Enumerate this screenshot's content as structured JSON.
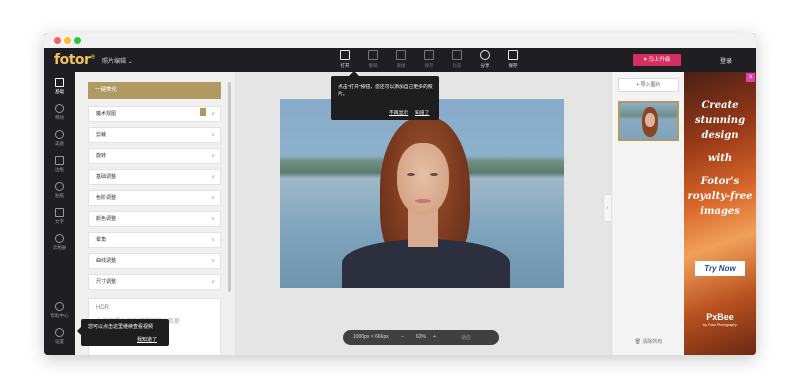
{
  "app": {
    "logo": "fotor",
    "logo_mark": "®",
    "menu_label": "照片编辑",
    "menu_arrow": "⌄",
    "upgrade_label": "马上升级",
    "upgrade_icon": "♥",
    "login_label": "登录"
  },
  "toolbar": [
    {
      "label": "打开",
      "active": true
    },
    {
      "label": "撤销",
      "active": false
    },
    {
      "label": "重做",
      "active": false
    },
    {
      "label": "保存",
      "active": false
    },
    {
      "label": "比较",
      "active": false
    },
    {
      "label": "分享",
      "active": true
    },
    {
      "label": "保存",
      "active": true
    }
  ],
  "leftnav": {
    "items": [
      {
        "label": "基础",
        "icon": "sliders-icon",
        "active": true
      },
      {
        "label": "特效",
        "icon": "flask-icon",
        "active": false
      },
      {
        "label": "美颜",
        "icon": "eye-icon",
        "active": false
      },
      {
        "label": "边框",
        "icon": "frame-icon",
        "active": false
      },
      {
        "label": "贴纸",
        "icon": "sticker-icon",
        "active": false
      },
      {
        "label": "文字",
        "icon": "text-icon",
        "active": false
      },
      {
        "label": "云相册",
        "icon": "cloud-icon",
        "active": false
      }
    ],
    "bottom": [
      {
        "label": "帮助中心",
        "icon": "help-icon"
      },
      {
        "label": "设置",
        "icon": "gear-icon"
      }
    ]
  },
  "panel": {
    "primary": "一键美化",
    "items": [
      {
        "label": "魔术观图",
        "badge": true
      },
      {
        "label": "剪裁"
      },
      {
        "label": "旋转"
      },
      {
        "label": "基础调整"
      },
      {
        "label": "色阶调整"
      },
      {
        "label": "颜色调整"
      },
      {
        "label": "晕角"
      },
      {
        "label": "曲线调整"
      },
      {
        "label": "尺寸调整"
      }
    ],
    "hdr_title": "HDR",
    "hdr_desc": "让你的照片更多细节阴影以及更"
  },
  "tooltip_top": {
    "text": "点击\"打开\"按钮，您还可以添加自己更多的照片。",
    "link1": "不再显示",
    "link2": "知道了"
  },
  "tooltip_bottom": {
    "text": "您可以点击这里继续查看视频",
    "link": "我知道了"
  },
  "zoombar": {
    "size": "1000px × 666px",
    "minus": "−",
    "zoom": "63%",
    "plus": "+",
    "fit": "适应"
  },
  "rightpanel": {
    "import_label": "导入图片",
    "import_icon": "+",
    "clear_label": "清除所有"
  },
  "ad": {
    "lines": [
      "Create",
      "stunning",
      "design",
      "with",
      "Fotor's",
      "royalty-free",
      "images"
    ],
    "cta": "Try Now",
    "brand": "PxBee",
    "sub": "by Fotor Photography"
  },
  "colors": {
    "accent": "#b19a61",
    "upgrade": "#d62e5f",
    "topbar": "#1f1f23"
  }
}
